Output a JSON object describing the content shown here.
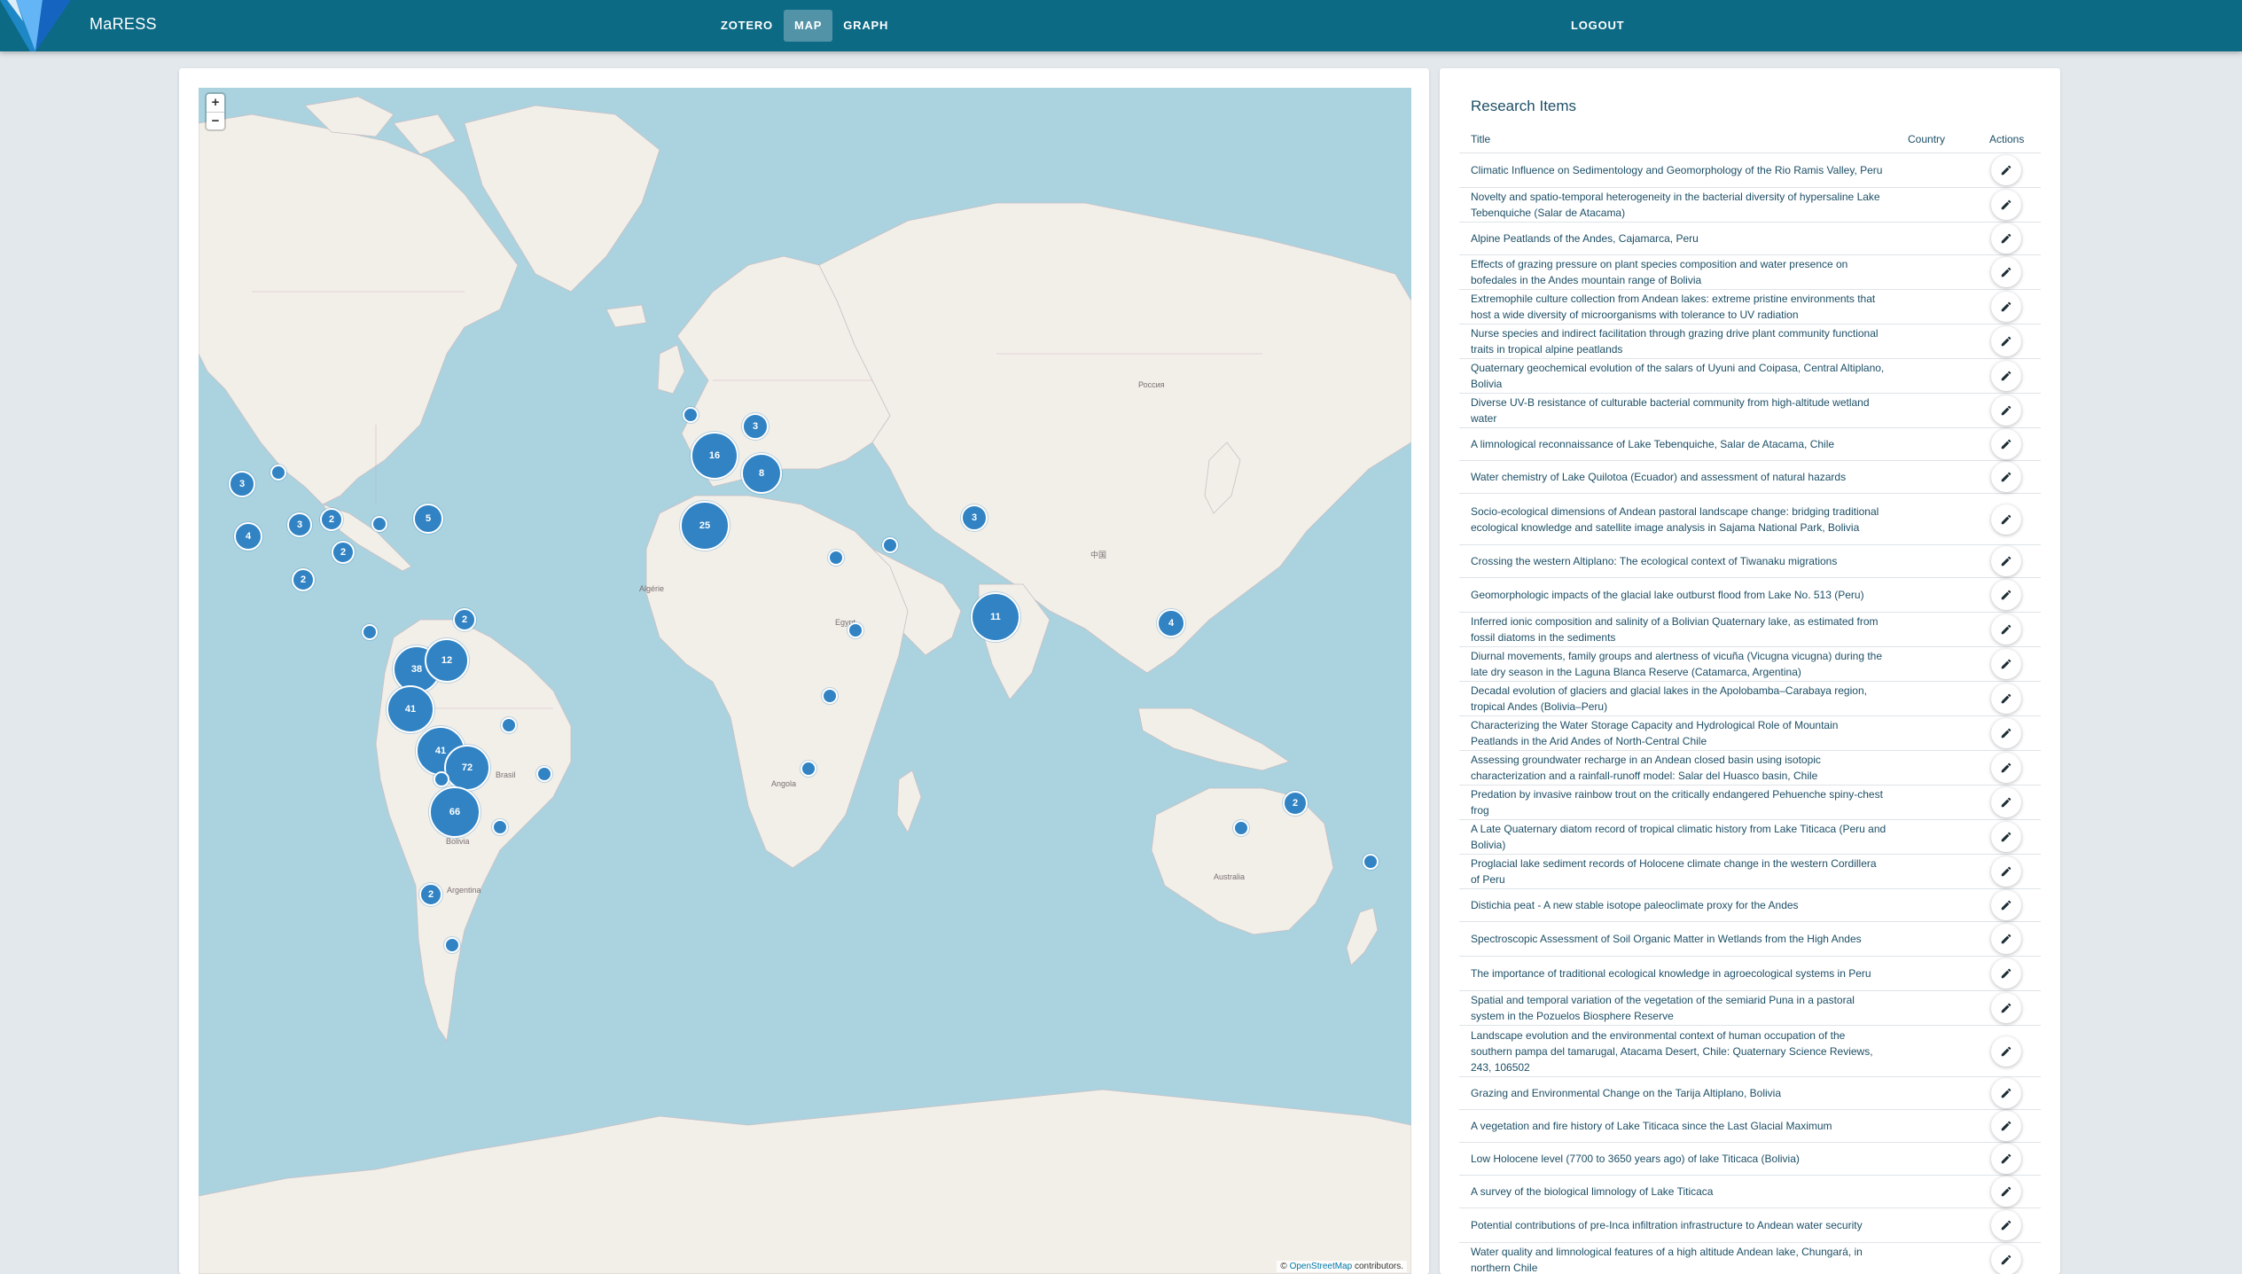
{
  "app": {
    "title": "MaRESS"
  },
  "nav": {
    "tabs": [
      {
        "label": "ZOTERO",
        "active": false
      },
      {
        "label": "MAP",
        "active": true
      },
      {
        "label": "GRAPH",
        "active": false
      }
    ],
    "logout_label": "LOGOUT"
  },
  "map": {
    "zoom_in": "+",
    "zoom_out": "−",
    "attribution_symbol": "©",
    "attribution_link": "OpenStreetMap",
    "attribution_suffix": "contributors.",
    "cluster_labels": [
      "3",
      "16",
      "8",
      "25",
      "3",
      "11",
      "4",
      "3",
      "4",
      "3",
      "2",
      "2",
      "5",
      "2",
      "2",
      "38",
      "12",
      "41",
      "41",
      "72",
      "66",
      "2",
      "2"
    ]
  },
  "research_items": {
    "title": "Research Items",
    "columns": {
      "title": "Title",
      "country": "Country",
      "actions": "Actions"
    },
    "rows": [
      "Climatic Influence on Sedimentology and Geomorphology of the Rio Ramis Valley, Peru",
      "Novelty and spatio-temporal heterogeneity in the bacterial diversity of hypersaline Lake Tebenquiche (Salar de Atacama)",
      "Alpine Peatlands of the Andes, Cajamarca, Peru",
      "Effects of grazing pressure on plant species composition and water presence on bofedales in the Andes mountain range of Bolivia",
      "Extremophile culture collection from Andean lakes: extreme pristine environments that host a wide diversity of microorganisms with tolerance to UV radiation",
      "Nurse species and indirect facilitation through grazing drive plant community functional traits in tropical alpine peatlands",
      "Quaternary geochemical evolution of the salars of Uyuni and Coipasa, Central Altiplano, Bolivia",
      "Diverse UV-B resistance of culturable bacterial community from high-altitude wetland water",
      "A limnological reconnaissance of Lake Tebenquiche, Salar de Atacama, Chile",
      "Water chemistry of Lake Quilotoa (Ecuador) and assessment of natural hazards",
      "Socio-ecological dimensions of Andean pastoral landscape change: bridging traditional ecological knowledge and satellite image analysis in Sajama National Park, Bolivia",
      "Crossing the western Altiplano: The ecological context of Tiwanaku migrations",
      "Geomorphologic impacts of the glacial lake outburst flood from Lake No. 513 (Peru)",
      "Inferred ionic composition and salinity of a Bolivian Quaternary lake, as estimated from fossil diatoms in the sediments",
      "Diurnal movements, family groups and alertness of vicuña (Vicugna vicugna) during the late dry season in the Laguna Blanca Reserve (Catamarca, Argentina)",
      "Decadal evolution of glaciers and glacial lakes in the Apolobamba–Carabaya region, tropical Andes (Bolivia–Peru)",
      "Characterizing the Water Storage Capacity and Hydrological Role of Mountain Peatlands in the Arid Andes of North-Central Chile",
      "Assessing groundwater recharge in an Andean closed basin using isotopic characterization and a rainfall-runoff model: Salar del Huasco basin, Chile",
      "Predation by invasive rainbow trout on the critically endangered Pehuenche spiny-chest frog",
      "A Late Quaternary diatom record of tropical climatic history from Lake Titicaca (Peru and Bolivia)",
      "Proglacial lake sediment records of Holocene climate change in the western Cordillera of Peru",
      "Distichia peat - A new stable isotope paleoclimate proxy for the Andes",
      "Spectroscopic Assessment of Soil Organic Matter in Wetlands from the High Andes",
      "The importance of traditional ecological knowledge in agroecological systems in Peru",
      "Spatial and temporal variation of the vegetation of the semiarid Puna in a pastoral system in the Pozuelos Biosphere Reserve",
      "Landscape evolution and the environmental context of human occupation of the southern pampa del tamarugal, Atacama Desert, Chile: Quaternary Science Reviews, 243, 106502",
      "Grazing and Environmental Change on the Tarija Altiplano, Bolivia",
      "A vegetation and fire history of Lake Titicaca since the Last Glacial Maximum",
      "Low Holocene level (7700 to 3650 years ago) of lake Titicaca (Bolivia)",
      "A survey of the biological limnology of Lake Titicaca",
      "Potential contributions of pre-Inca infiltration infrastructure to Andean water security",
      "Water quality and limnological features of a high altitude Andean lake, Chungará, in northern Chile"
    ]
  }
}
